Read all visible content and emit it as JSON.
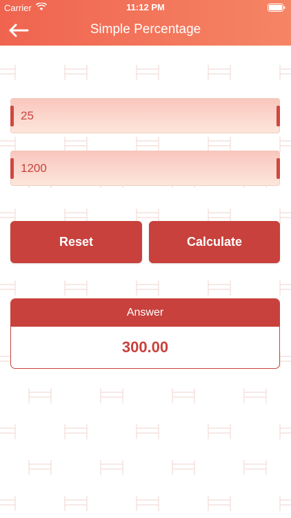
{
  "status_bar": {
    "carrier": "Carrier",
    "time": "11:12 PM"
  },
  "nav": {
    "title": "Simple Percentage",
    "back_icon": "arrow-left-icon"
  },
  "inputs": {
    "percent": {
      "value": "25"
    },
    "amount": {
      "value": "1200"
    }
  },
  "buttons": {
    "reset": "Reset",
    "calculate": "Calculate"
  },
  "answer": {
    "label": "Answer",
    "value": "300.00"
  },
  "colors": {
    "header_start": "#f0644f",
    "header_end": "#f58565",
    "accent": "#c8413c",
    "field_bg": "#fde6db"
  }
}
